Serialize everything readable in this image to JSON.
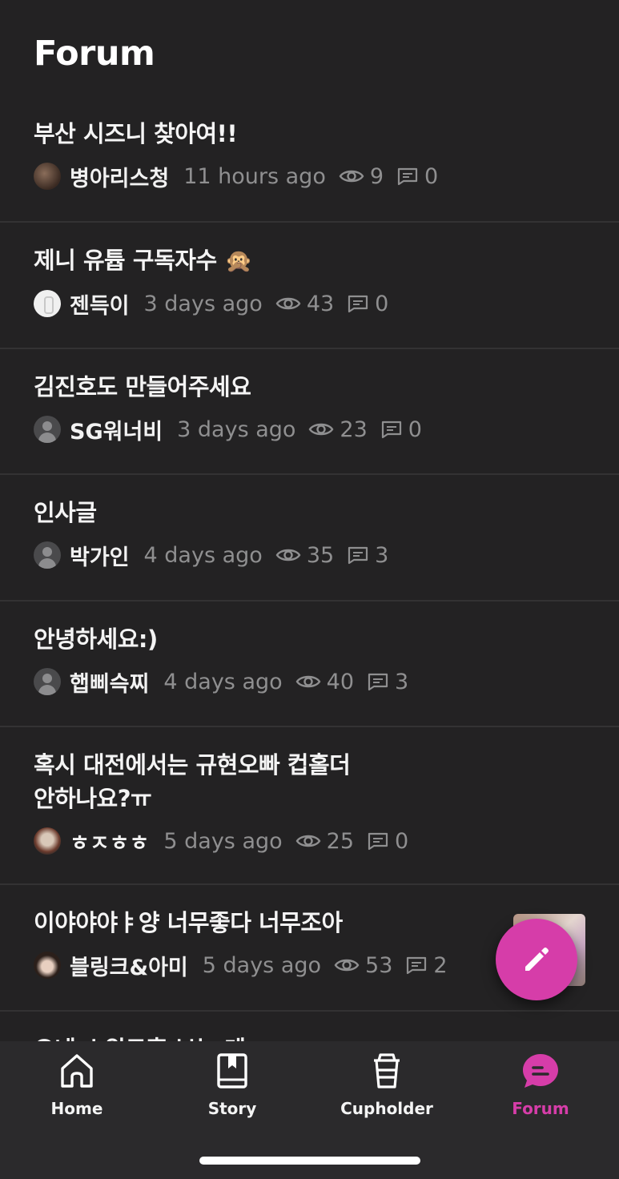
{
  "header": {
    "title": "Forum"
  },
  "posts": [
    {
      "title": "부산 시즈니 찾아여!!",
      "author": "병아리스청",
      "time": "11 hours ago",
      "views": "9",
      "comments": "0",
      "avatar": "photo1"
    },
    {
      "title": "제니 유튭 구독자수",
      "emoji": "🙊",
      "author": "젠득이",
      "time": "3 days ago",
      "views": "43",
      "comments": "0",
      "avatar": "white"
    },
    {
      "title": "김진호도 만들어주세요",
      "author": "SG워너비",
      "time": "3 days ago",
      "views": "23",
      "comments": "0",
      "avatar": "default"
    },
    {
      "title": "인사글",
      "author": "박가인",
      "time": "4 days ago",
      "views": "35",
      "comments": "3",
      "avatar": "default"
    },
    {
      "title": "안녕하세요:)",
      "author": "햅삐슥찌",
      "time": "4 days ago",
      "views": "40",
      "comments": "3",
      "avatar": "default"
    },
    {
      "title_line1": "혹시 대전에서는 규현오빠 컵홀더",
      "title_line2": "안하나요?ㅠ",
      "author": "ㅎㅈㅎㅎ",
      "time": "5 days ago",
      "views": "25",
      "comments": "0",
      "avatar": "photo2"
    },
    {
      "title": "이야야야ㅑ양 너무좋다 너무조아",
      "author": "블링크&아미",
      "time": "5 days ago",
      "views": "53",
      "comments": "2",
      "avatar": "photo3",
      "has_thumbnail": true
    },
    {
      "title": "오네 스위트홈 보는 데"
    }
  ],
  "tabs": [
    {
      "label": "Home",
      "icon": "home-icon"
    },
    {
      "label": "Story",
      "icon": "book-icon"
    },
    {
      "label": "Cupholder",
      "icon": "cup-icon"
    },
    {
      "label": "Forum",
      "icon": "chat-bubble-icon",
      "active": true
    }
  ],
  "colors": {
    "background": "#232223",
    "accent": "#d63da9",
    "muted": "#8f8f90",
    "tabbar": "#2b2a2c"
  }
}
